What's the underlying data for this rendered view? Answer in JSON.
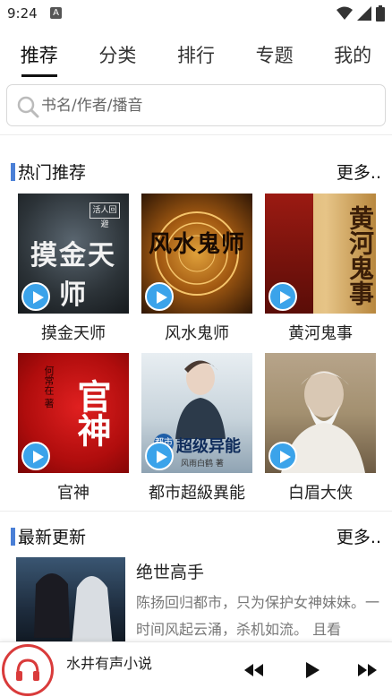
{
  "status_bar": {
    "time": "9:24",
    "notification_letter": "A"
  },
  "tabs": [
    {
      "label": "推荐",
      "active": true
    },
    {
      "label": "分类"
    },
    {
      "label": "排行"
    },
    {
      "label": "专题"
    },
    {
      "label": "我的"
    }
  ],
  "search": {
    "placeholder": "书名/作者/播音"
  },
  "hot": {
    "title": "热门推荐",
    "more": "更多..",
    "books": [
      {
        "name": "摸金天师",
        "cover_text": "摸金天师",
        "cover_sub": "活人回避"
      },
      {
        "name": "风水鬼师",
        "cover_text": "风水鬼师"
      },
      {
        "name": "黄河鬼事",
        "cover_text": "黄河鬼事"
      },
      {
        "name": "官神",
        "cover_text": "官神",
        "cover_sub": "何常在 著"
      },
      {
        "name": "都市超級異能",
        "cover_text": "超级异能",
        "cover_sub": "都市",
        "cover_author": "风雨白鹤 著"
      },
      {
        "name": "白眉大侠",
        "cover_text": ""
      }
    ]
  },
  "latest": {
    "title": "最新更新",
    "more": "更多..",
    "item": {
      "title": "绝世高手",
      "description": "陈扬回归都市，只为保护女神妹妹。一时间风起云涌，杀机如流。 且看"
    }
  },
  "player": {
    "title": "水井有声小说"
  },
  "colors": {
    "accent": "#4a7fd6",
    "play": "#3ba3ea",
    "player_ring": "#d93b3b"
  }
}
